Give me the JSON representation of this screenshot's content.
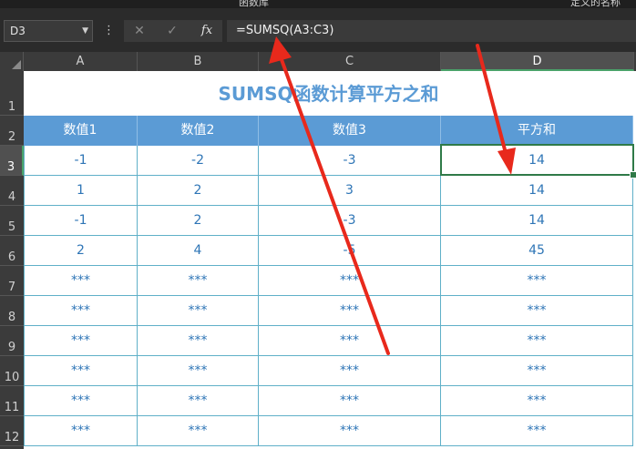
{
  "top_strip": {
    "left_text": "函数库",
    "right_text": "定义的名称"
  },
  "formula_bar": {
    "name_box": "D3",
    "cancel_glyph": "✕",
    "enter_glyph": "✓",
    "fx_label": "fx",
    "formula": "=SUMSQ(A3:C3)"
  },
  "columns": [
    "A",
    "B",
    "C",
    "D"
  ],
  "rows": [
    "1",
    "2",
    "3",
    "4",
    "5",
    "6",
    "7",
    "8",
    "9",
    "10",
    "11",
    "12"
  ],
  "selected_cell": {
    "column": "D",
    "row": "3"
  },
  "sheet": {
    "title": "SUMSQ函数计算平方之和",
    "headers": [
      "数值1",
      "数值2",
      "数值3",
      "平方和"
    ],
    "data": [
      [
        "-1",
        "-2",
        "-3",
        "14"
      ],
      [
        "1",
        "2",
        "3",
        "14"
      ],
      [
        "-1",
        "2",
        "-3",
        "14"
      ],
      [
        "2",
        "4",
        "-5",
        "45"
      ],
      [
        "***",
        "***",
        "***",
        "***"
      ],
      [
        "***",
        "***",
        "***",
        "***"
      ],
      [
        "***",
        "***",
        "***",
        "***"
      ],
      [
        "***",
        "***",
        "***",
        "***"
      ],
      [
        "***",
        "***",
        "***",
        "***"
      ],
      [
        "***",
        "***",
        "***",
        "***"
      ]
    ]
  },
  "colors": {
    "header_fill": "#5b9bd5",
    "title_text": "#5b9bd5",
    "cell_text": "#2e75b6",
    "grid_line": "#5fb0c8",
    "selection": "#2f7a48",
    "annotation_arrow": "#e8291c"
  }
}
